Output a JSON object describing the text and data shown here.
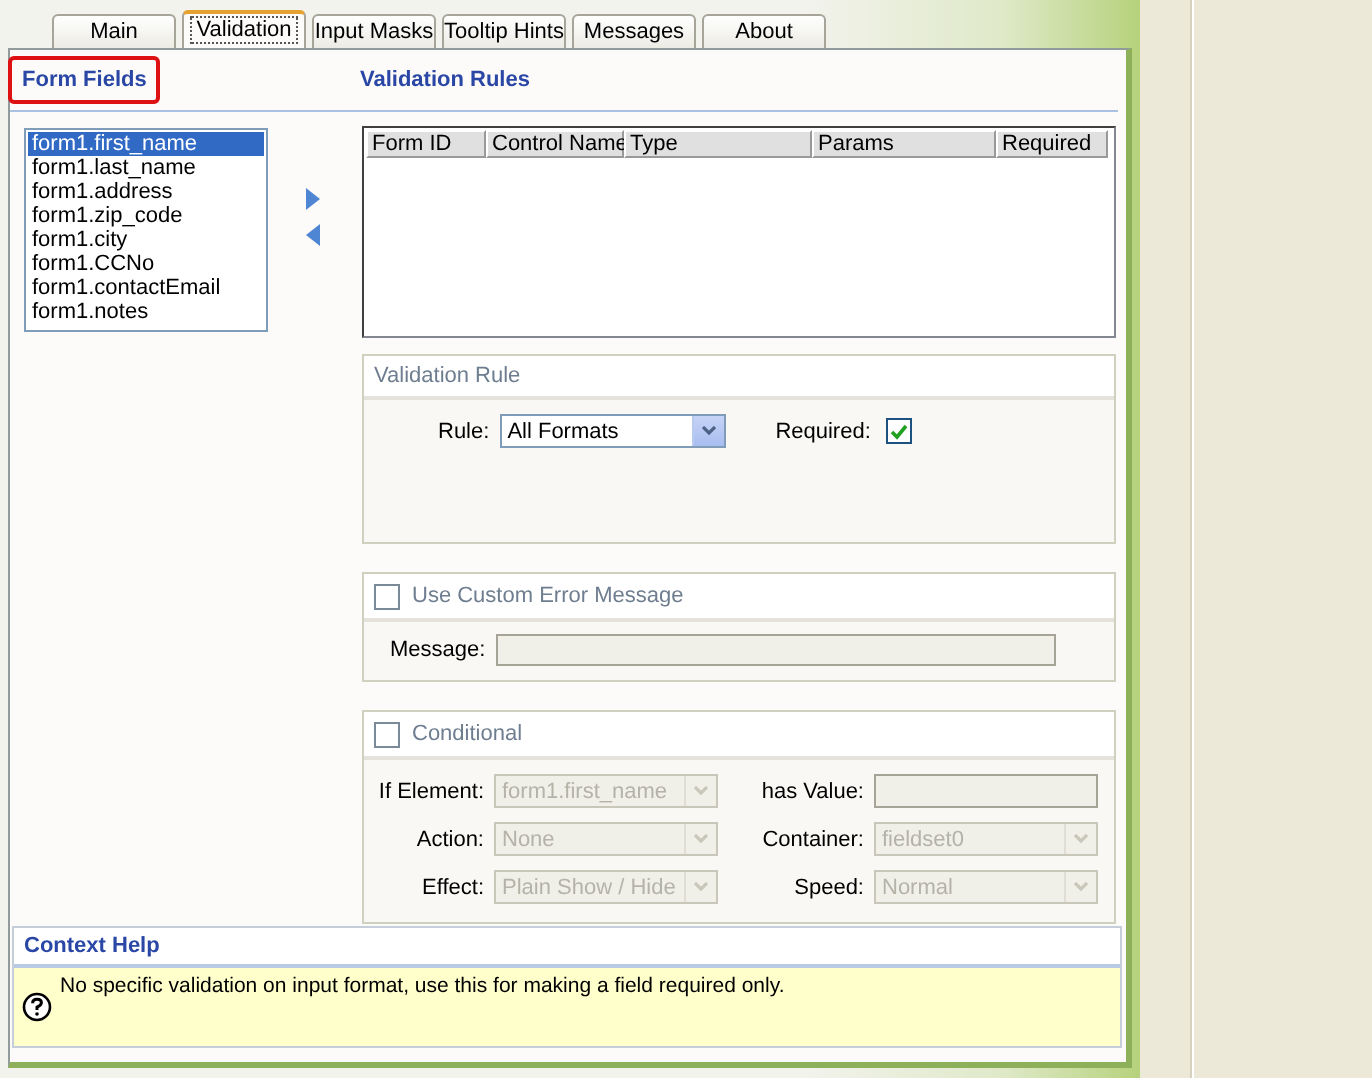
{
  "tabs": [
    {
      "label": "Main",
      "selected": false
    },
    {
      "label": "Validation",
      "selected": true
    },
    {
      "label": "Input Masks",
      "selected": false
    },
    {
      "label": "Tooltip Hints",
      "selected": false
    },
    {
      "label": "Messages",
      "selected": false
    },
    {
      "label": "About",
      "selected": false
    }
  ],
  "form_fields": {
    "title": "Form Fields",
    "items": [
      {
        "label": "form1.first_name",
        "selected": true
      },
      {
        "label": "form1.last_name",
        "selected": false
      },
      {
        "label": "form1.address",
        "selected": false
      },
      {
        "label": "form1.zip_code",
        "selected": false
      },
      {
        "label": "form1.city",
        "selected": false
      },
      {
        "label": "form1.CCNo",
        "selected": false
      },
      {
        "label": "form1.contactEmail",
        "selected": false
      },
      {
        "label": "form1.notes",
        "selected": false
      }
    ]
  },
  "validation_rules": {
    "title": "Validation Rules",
    "table": {
      "columns": [
        "Form ID",
        "Control Name",
        "Type",
        "Params",
        "Required"
      ]
    }
  },
  "validation_rule": {
    "title": "Validation Rule",
    "rule_label": "Rule:",
    "rule_value": "All Formats",
    "required_label": "Required:",
    "required_checked": true
  },
  "custom_error": {
    "label": "Use Custom Error Message",
    "checked": false,
    "message_label": "Message:",
    "message_disabled": true
  },
  "conditional": {
    "label": "Conditional",
    "checked": false,
    "fields": [
      {
        "label": "If Element:",
        "kind": "select",
        "value": "form1.first_name",
        "disabled": true
      },
      {
        "label": "has Value:",
        "kind": "text",
        "disabled": true
      },
      {
        "label": "Action:",
        "kind": "select",
        "value": "None",
        "disabled": true
      },
      {
        "label": "Container:",
        "kind": "select",
        "value": "fieldset0",
        "disabled": true
      },
      {
        "label": "Effect:",
        "kind": "select",
        "value": "Plain Show / Hide",
        "disabled": true
      },
      {
        "label": "Speed:",
        "kind": "select",
        "value": "Normal",
        "disabled": true
      }
    ]
  },
  "context_help": {
    "title": "Context Help",
    "text": "No specific validation on input format, use this for making a field required only."
  }
}
